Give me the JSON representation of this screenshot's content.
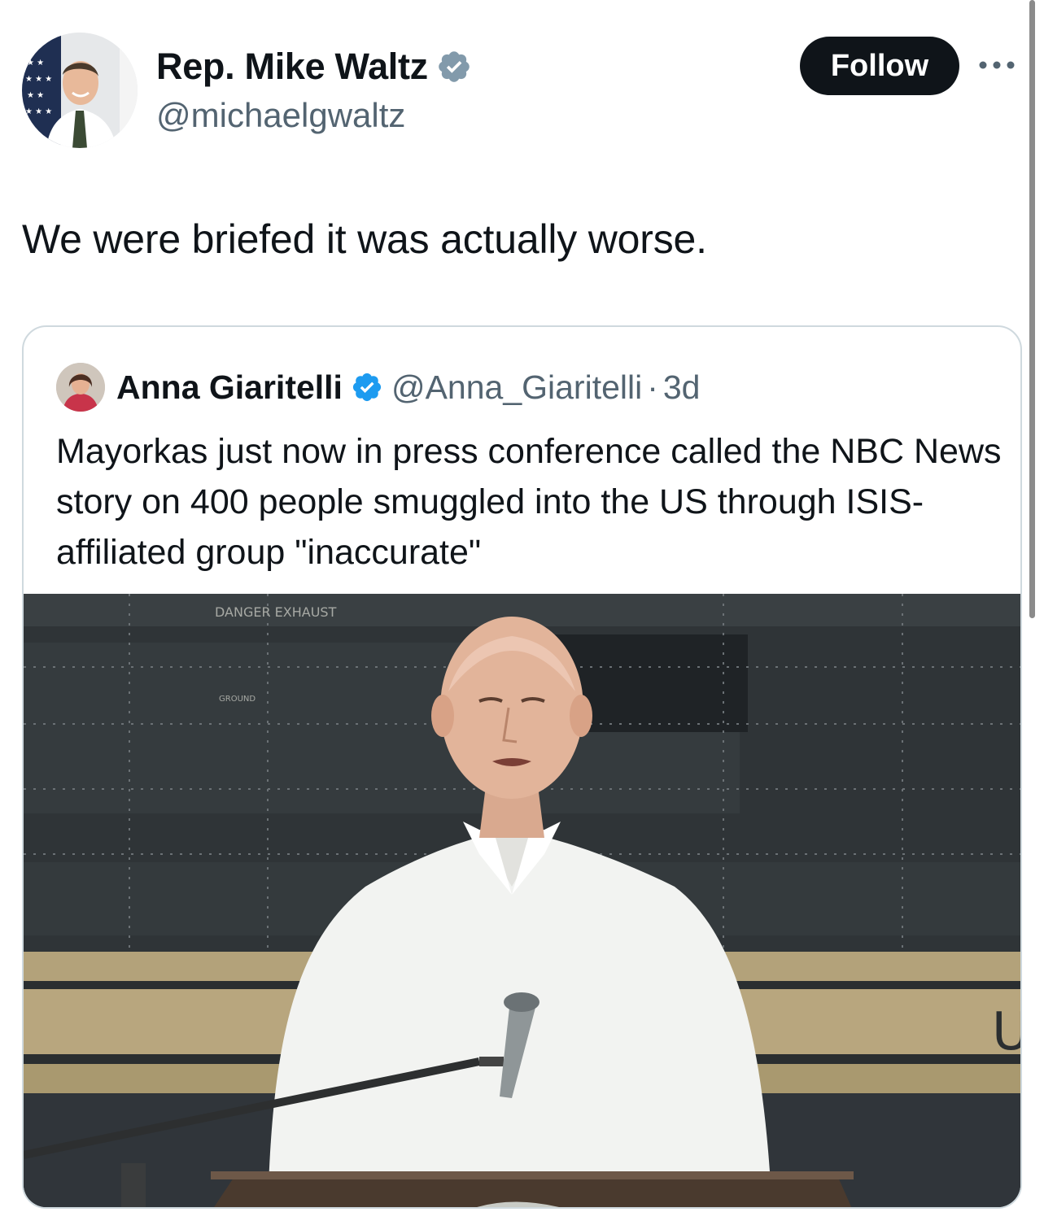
{
  "author": {
    "name": "Rep. Mike Waltz",
    "handle": "@michaelgwaltz",
    "verified": true,
    "avatar_icon": "profile-photo"
  },
  "actions": {
    "follow_label": "Follow",
    "more_icon": "more-horizontal-icon"
  },
  "tweet": {
    "text": "We were briefed it was actually worse."
  },
  "quote": {
    "name": "Anna Giaritelli",
    "handle": "@Anna_Giaritelli",
    "separator": "·",
    "time": "3d",
    "verified": true,
    "text": "Mayorkas just now in press conference called the NBC News story on 400 people smuggled into the US through ISIS-affiliated group \"inaccurate\"",
    "media": {
      "icon": "press-conference-photo",
      "visible_text": [
        "DANGER EXHAUST",
        "GROUND",
        "U"
      ]
    }
  },
  "colors": {
    "text_primary": "#0f1419",
    "text_secondary": "#536471",
    "verified_blue": "#1d9bf0",
    "verified_gray": "#829aab",
    "border": "#cfd9de",
    "follow_bg": "#0f1419"
  }
}
